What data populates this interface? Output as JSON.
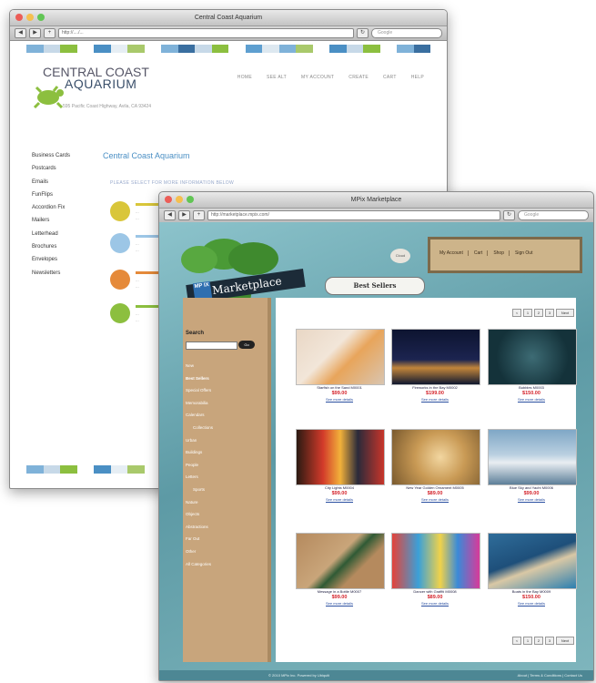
{
  "back_window": {
    "title": "Central Coast Aquarium",
    "url": "http://..../...",
    "search_placeholder": "Google",
    "logo_line1": "CENTRAL COAST",
    "logo_line2": "AQUARIUM",
    "address": "595 Pacific Coast Highway, Avila, CA 93424",
    "nav": [
      "HOME",
      "SEE ALT",
      "MY ACCOUNT",
      "CREATE",
      "CART",
      "HELP"
    ],
    "sidebar": [
      "Business Cards",
      "Postcards",
      "Emails",
      "FunFlips",
      "Accordion Fix",
      "Mailers",
      "Letterhead",
      "Brochures",
      "Envelopes",
      "Newsletters"
    ],
    "heading": "Central Coast Aquarium",
    "subheading": "PLEASE SELECT FOR MORE INFORMATION BELOW",
    "features": [
      {
        "line1": "...",
        "line2": "..."
      },
      {
        "line1": "...",
        "line2": "..."
      },
      {
        "line1": "...",
        "line2": "..."
      },
      {
        "line1": "...",
        "line2": "..."
      }
    ],
    "stripe_colors": [
      "#7fb2d9",
      "#c7d9e8",
      "#8cbf3f",
      "#ffffff",
      "#4a8fc4",
      "#e6eef4",
      "#a9c96b",
      "#ffffff",
      "#7fb2d9",
      "#3a6fa0",
      "#c7d9e8",
      "#8cbf3f",
      "#ffffff",
      "#5e9fd0",
      "#dde8f0",
      "#7fb2d9",
      "#a9c96b",
      "#ffffff",
      "#4a8fc4",
      "#c7d9e8",
      "#8cbf3f",
      "#ffffff",
      "#7fb2d9",
      "#3a6fa0"
    ]
  },
  "front_window": {
    "title": "MPix Marketplace",
    "url": "http://marketplace.mpix.com/",
    "search_placeholder": "Google",
    "logo_badge": "MP IX",
    "logo_text": "Marketplace",
    "cloud_label": "Cloud",
    "sign_nav": [
      "My Account",
      "Cart",
      "Shop",
      "Sign Out"
    ],
    "section_title": "Best Sellers",
    "search_label": "Search",
    "search_go": "Go",
    "categories": [
      "New",
      "Best Sellers",
      "Special Offers",
      "Memorabilia",
      "Calendars",
      "Collections",
      "Urban",
      "Buildings",
      "People",
      "Letters",
      "Sports",
      "Nature",
      "Objects",
      "Abstractions",
      "Far Out",
      "Other",
      "All Categories"
    ],
    "pager": [
      "<",
      "1",
      "2",
      "3",
      "Next"
    ],
    "products": [
      {
        "name": "Starfish on the Sand M0001",
        "price": "$99.00",
        "link": "See more details"
      },
      {
        "name": "Fireworks in the Bay M0002",
        "price": "$199.00",
        "link": "See more details"
      },
      {
        "name": "Bubbles M0003",
        "price": "$150.00",
        "link": "See more details"
      },
      {
        "name": "City Lights M0004",
        "price": "$99.00",
        "link": "See more details"
      },
      {
        "name": "New Year Golden Ornament M0005",
        "price": "$89.00",
        "link": "See more details"
      },
      {
        "name": "Blue Sky and Yacht M0006",
        "price": "$99.00",
        "link": "See more details"
      },
      {
        "name": "Message in a Bottle M0007",
        "price": "$99.00",
        "link": "See more details"
      },
      {
        "name": "Dancer with Graffiti M0008",
        "price": "$89.00",
        "link": "See more details"
      },
      {
        "name": "Boats in the Bay M0009",
        "price": "$150.00",
        "link": "See more details"
      }
    ],
    "footer_left": "© 2010 MPix Inc. Powered by Ubiquiti",
    "footer_right": "About | Terms & Conditions | Contact Us"
  }
}
